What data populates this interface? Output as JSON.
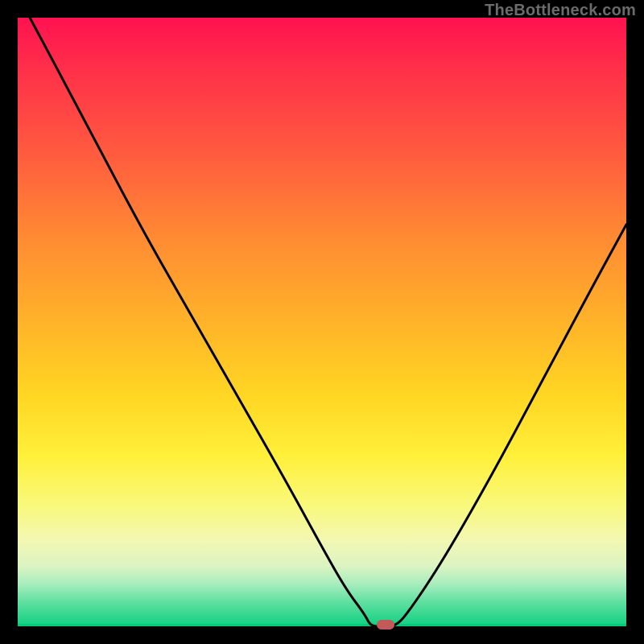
{
  "watermark": "TheBottleneck.com",
  "colors": {
    "background": "#000000",
    "gradient_top": "#ff1250",
    "gradient_mid": "#ffd623",
    "gradient_bottom": "#0fd082",
    "curve": "#000000",
    "marker": "#c25a5a"
  },
  "chart_data": {
    "type": "line",
    "title": "",
    "xlabel": "",
    "ylabel": "",
    "xlim": [
      0,
      100
    ],
    "ylim": [
      0,
      100
    ],
    "series": [
      {
        "name": "bottleneck-curve",
        "x": [
          2,
          10,
          20,
          28,
          36,
          44,
          50,
          54,
          57,
          58,
          60,
          62,
          64,
          70,
          78,
          86,
          94,
          100
        ],
        "y": [
          100,
          85,
          66,
          52,
          38,
          24,
          13,
          6,
          2,
          0,
          0,
          0,
          2,
          11,
          25,
          40,
          55,
          66
        ]
      }
    ],
    "marker": {
      "x": 60.5,
      "y": 0,
      "label": "optimal-point"
    }
  }
}
